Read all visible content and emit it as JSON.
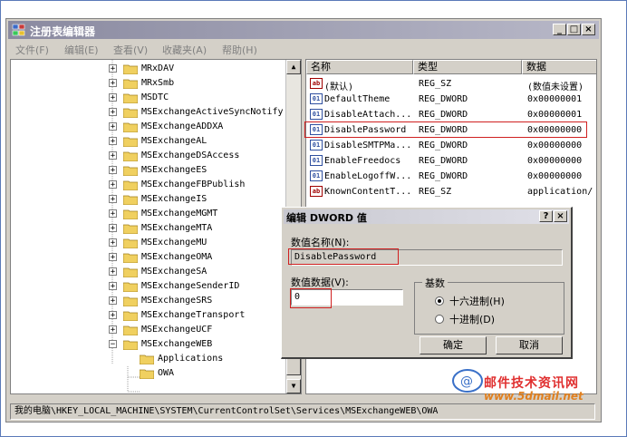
{
  "window": {
    "title": "注册表编辑器"
  },
  "menu": [
    "文件(F)",
    "编辑(E)",
    "查看(V)",
    "收藏夹(A)",
    "帮助(H)"
  ],
  "tree": {
    "items": [
      {
        "label": "MRxDAV",
        "state": "+"
      },
      {
        "label": "MRxSmb",
        "state": "+"
      },
      {
        "label": "MSDTC",
        "state": "+"
      },
      {
        "label": "MSExchangeActiveSyncNotify",
        "state": "+"
      },
      {
        "label": "MSExchangeADDXA",
        "state": "+"
      },
      {
        "label": "MSExchangeAL",
        "state": "+"
      },
      {
        "label": "MSExchangeDSAccess",
        "state": "+"
      },
      {
        "label": "MSExchangeES",
        "state": "+"
      },
      {
        "label": "MSExchangeFBPublish",
        "state": "+"
      },
      {
        "label": "MSExchangeIS",
        "state": "+"
      },
      {
        "label": "MSExchangeMGMT",
        "state": "+"
      },
      {
        "label": "MSExchangeMTA",
        "state": "+"
      },
      {
        "label": "MSExchangeMU",
        "state": "+"
      },
      {
        "label": "MSExchangeOMA",
        "state": "+"
      },
      {
        "label": "MSExchangeSA",
        "state": "+"
      },
      {
        "label": "MSExchangeSenderID",
        "state": "+"
      },
      {
        "label": "MSExchangeSRS",
        "state": "+"
      },
      {
        "label": "MSExchangeTransport",
        "state": "+"
      },
      {
        "label": "MSExchangeUCF",
        "state": "+"
      },
      {
        "label": "MSExchangeWEB",
        "state": "-"
      }
    ],
    "children": [
      {
        "label": "Applications"
      },
      {
        "label": "OWA"
      }
    ]
  },
  "list": {
    "columns": [
      "名称",
      "类型",
      "数据"
    ],
    "rows": [
      {
        "name": "(默认)",
        "type": "REG_SZ",
        "data": "(数值未设置)",
        "icon": "ab"
      },
      {
        "name": "DefaultTheme",
        "type": "REG_DWORD",
        "data": "0x00000001",
        "icon": "01"
      },
      {
        "name": "DisableAttach...",
        "type": "REG_DWORD",
        "data": "0x00000001",
        "icon": "01"
      },
      {
        "name": "DisablePassword",
        "type": "REG_DWORD",
        "data": "0x00000000",
        "icon": "01"
      },
      {
        "name": "DisableSMTPMa...",
        "type": "REG_DWORD",
        "data": "0x00000000",
        "icon": "01"
      },
      {
        "name": "EnableFreedocs",
        "type": "REG_DWORD",
        "data": "0x00000000",
        "icon": "01"
      },
      {
        "name": "EnableLogoffW...",
        "type": "REG_DWORD",
        "data": "0x00000000",
        "icon": "01"
      },
      {
        "name": "KnownContentT...",
        "type": "REG_SZ",
        "data": "application/",
        "icon": "ab"
      }
    ]
  },
  "dialog": {
    "title": "编辑 DWORD 值",
    "help": "?",
    "close": "×",
    "name_label": "数值名称(N):",
    "name_value": "DisablePassword",
    "data_label": "数值数据(V):",
    "data_value": "0",
    "base_label": "基数",
    "hex_label": "十六进制(H)",
    "dec_label": "十进制(D)",
    "ok": "确定",
    "cancel": "取消"
  },
  "status": "我的电脑\\HKEY_LOCAL_MACHINE\\SYSTEM\\CurrentControlSet\\Services\\MSExchangeWEB\\OWA",
  "watermark": {
    "line1": "邮件技术资讯网",
    "line2": "www.5dmail.net"
  }
}
